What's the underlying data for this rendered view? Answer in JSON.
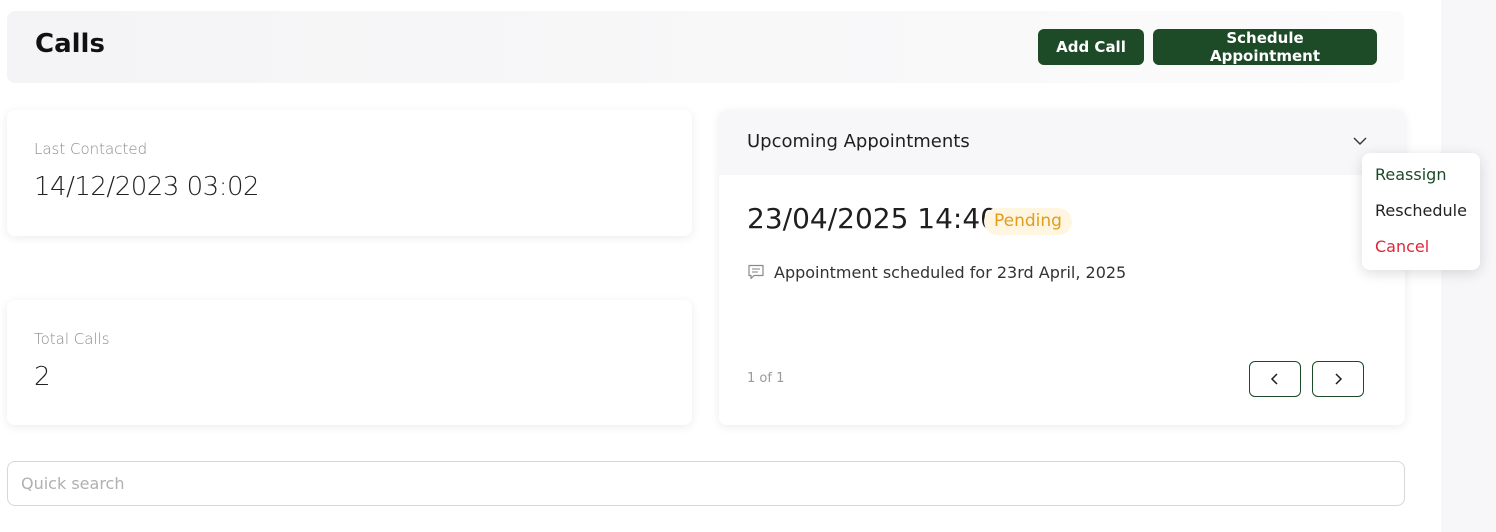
{
  "header": {
    "title": "Calls",
    "add_call_label": "Add Call",
    "schedule_label": "Schedule Appointment"
  },
  "stats": {
    "last_contacted_label": "Last Contacted",
    "last_contacted_value": "14/12/2023 03:02",
    "total_calls_label": "Total Calls",
    "total_calls_value": "2"
  },
  "appointments": {
    "title": "Upcoming Appointments",
    "datetime": "23/04/2025 14:40",
    "status": "Pending",
    "note": "Appointment scheduled for 23rd April, 2025",
    "pager": "1 of 1"
  },
  "menu": {
    "reassign": "Reassign",
    "reschedule": "Reschedule",
    "cancel": "Cancel"
  },
  "search": {
    "placeholder": "Quick search"
  },
  "colors": {
    "primary": "#1d4a27",
    "pending_text": "#e39b1c",
    "pending_bg": "#fff6e2",
    "danger": "#e0263b"
  }
}
